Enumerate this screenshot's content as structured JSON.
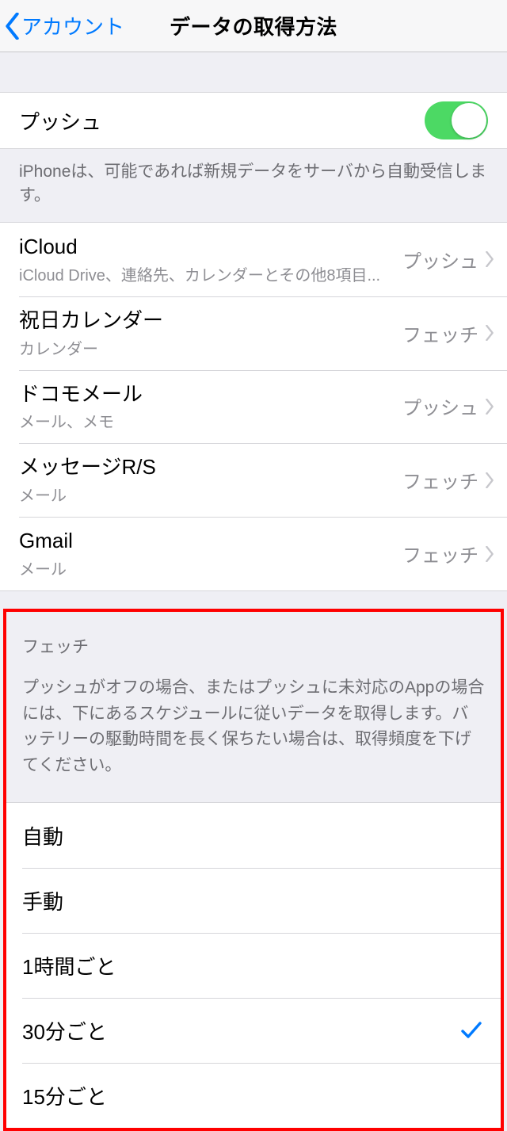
{
  "nav": {
    "back_label": "アカウント",
    "title": "データの取得方法"
  },
  "push": {
    "label": "プッシュ",
    "enabled": true,
    "footer": "iPhoneは、可能であれば新規データをサーバから自動受信します。"
  },
  "accounts": [
    {
      "title": "iCloud",
      "subtitle": "iCloud Drive、連絡先、カレンダーとその他8項目...",
      "mode": "プッシュ"
    },
    {
      "title": "祝日カレンダー",
      "subtitle": "カレンダー",
      "mode": "フェッチ"
    },
    {
      "title": "ドコモメール",
      "subtitle": "メール、メモ",
      "mode": "プッシュ"
    },
    {
      "title": "メッセージR/S",
      "subtitle": "メール",
      "mode": "フェッチ"
    },
    {
      "title": "Gmail",
      "subtitle": "メール",
      "mode": "フェッチ"
    }
  ],
  "fetch": {
    "header": "フェッチ",
    "description": "プッシュがオフの場合、またはプッシュに未対応のAppの場合には、下にあるスケジュールに従いデータを取得します。バッテリーの駆動時間を長く保ちたい場合は、取得頻度を下げてください。",
    "options": [
      {
        "label": "自動",
        "selected": false
      },
      {
        "label": "手動",
        "selected": false
      },
      {
        "label": "1時間ごと",
        "selected": false
      },
      {
        "label": "30分ごと",
        "selected": true
      },
      {
        "label": "15分ごと",
        "selected": false
      }
    ]
  },
  "colors": {
    "tint": "#007aff",
    "switch_on": "#4cd964",
    "highlight_border": "#ff0000"
  }
}
